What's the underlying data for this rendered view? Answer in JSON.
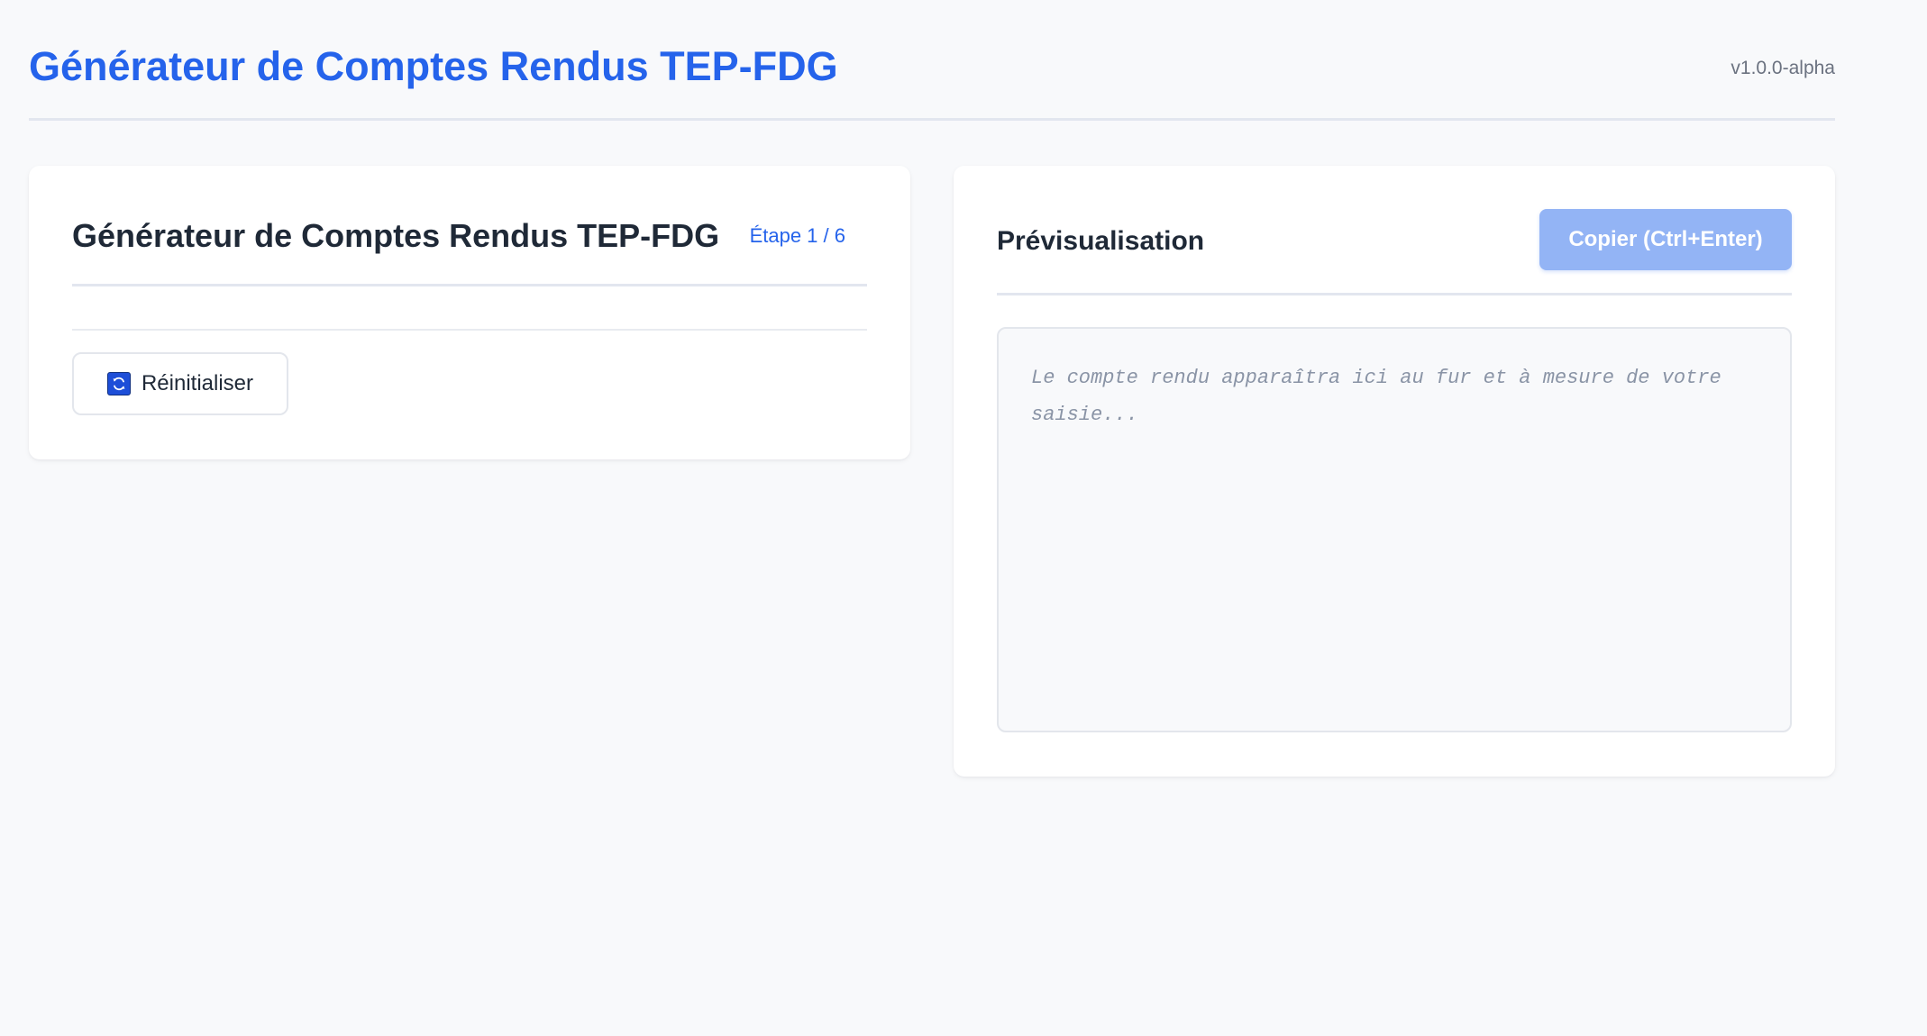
{
  "header": {
    "title": "Générateur de Comptes Rendus TEP-FDG",
    "version": "v1.0.0-alpha"
  },
  "form_panel": {
    "title": "Générateur de Comptes Rendus TEP-FDG",
    "step_indicator": "Étape 1 / 6",
    "reset_button": {
      "icon": "refresh-icon",
      "label": "Réinitialiser"
    }
  },
  "preview_panel": {
    "title": "Prévisualisation",
    "copy_button_label": "Copier (Ctrl+Enter)",
    "placeholder": "Le compte rendu apparaîtra ici au fur et à mesure de votre saisie..."
  },
  "colors": {
    "accent": "#2563eb",
    "copy_button_disabled": "#93b4f5",
    "page_background": "#f8f9fb"
  }
}
